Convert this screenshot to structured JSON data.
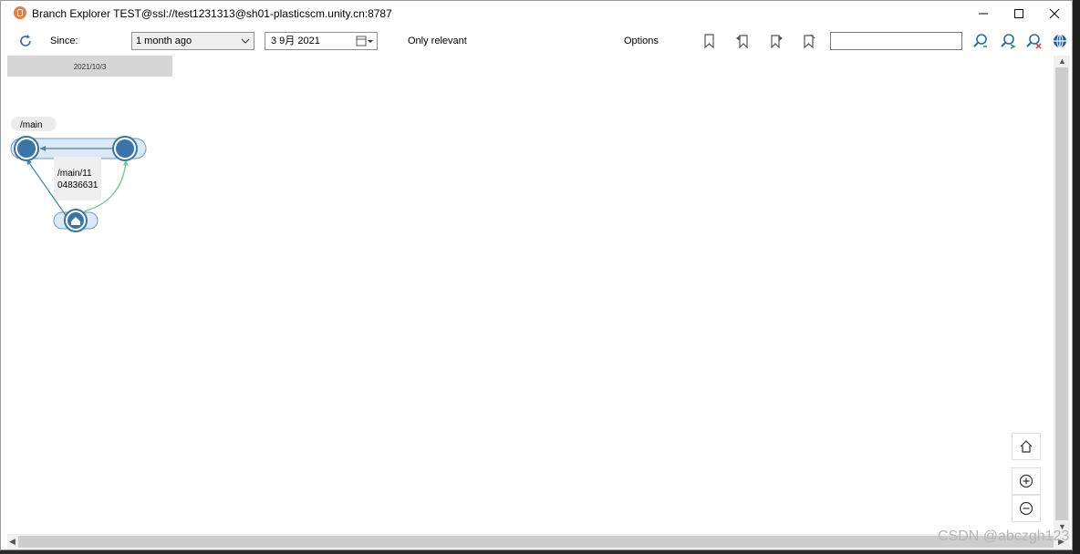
{
  "window": {
    "title": "Branch Explorer TEST@ssl://test1231313@sh01-plasticscm.unity.cn:8787",
    "icons": [
      "plastic-scm-logo-icon",
      "minimize-icon",
      "maximize-icon",
      "close-icon"
    ]
  },
  "toolbar": {
    "since_label": "Since:",
    "since_value": "1 month ago",
    "date_value": "3  9月  2021",
    "only_relevant": "Only relevant",
    "options": "Options",
    "search_placeholder": "",
    "icons": [
      "refresh-icon",
      "bookmark-icon",
      "bookmark-back-icon",
      "bookmark-next-icon",
      "bookmark-clear-icon",
      "search-prev-icon",
      "search-next-icon",
      "search-clear-icon",
      "globe-icon"
    ]
  },
  "canvas": {
    "date_header": "2021/10/3",
    "branch_label": "/main",
    "child_branch_label_line1": "/main/11",
    "child_branch_label_line2": "04836631"
  },
  "zoom": {
    "icons": [
      "home-icon",
      "zoom-in-icon",
      "zoom-out-icon"
    ]
  },
  "watermark": "CSDN @abczgh123",
  "colors": {
    "changeset_fill": "#3a74a8",
    "branch_fill": "#dde9f2",
    "merge_line": "#6fcf8f",
    "link_line": "#3f86a6"
  }
}
